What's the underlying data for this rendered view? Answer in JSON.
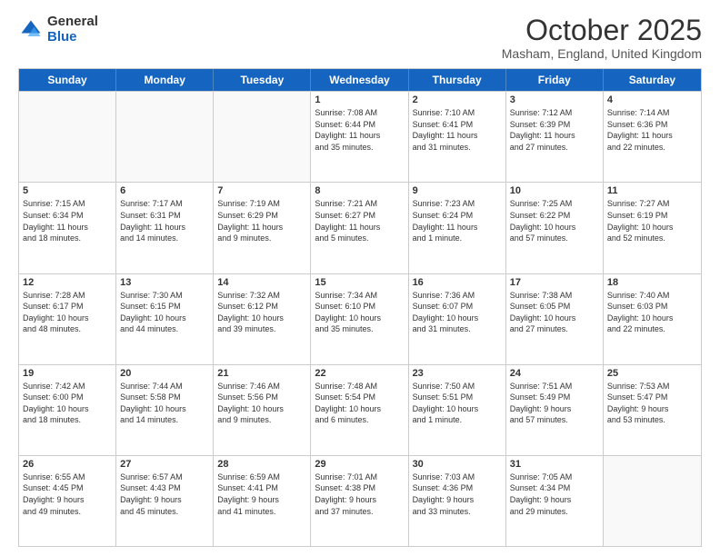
{
  "header": {
    "logo_general": "General",
    "logo_blue": "Blue",
    "month_title": "October 2025",
    "location": "Masham, England, United Kingdom"
  },
  "days_of_week": [
    "Sunday",
    "Monday",
    "Tuesday",
    "Wednesday",
    "Thursday",
    "Friday",
    "Saturday"
  ],
  "weeks": [
    [
      {
        "day": "",
        "info": ""
      },
      {
        "day": "",
        "info": ""
      },
      {
        "day": "",
        "info": ""
      },
      {
        "day": "1",
        "info": "Sunrise: 7:08 AM\nSunset: 6:44 PM\nDaylight: 11 hours\nand 35 minutes."
      },
      {
        "day": "2",
        "info": "Sunrise: 7:10 AM\nSunset: 6:41 PM\nDaylight: 11 hours\nand 31 minutes."
      },
      {
        "day": "3",
        "info": "Sunrise: 7:12 AM\nSunset: 6:39 PM\nDaylight: 11 hours\nand 27 minutes."
      },
      {
        "day": "4",
        "info": "Sunrise: 7:14 AM\nSunset: 6:36 PM\nDaylight: 11 hours\nand 22 minutes."
      }
    ],
    [
      {
        "day": "5",
        "info": "Sunrise: 7:15 AM\nSunset: 6:34 PM\nDaylight: 11 hours\nand 18 minutes."
      },
      {
        "day": "6",
        "info": "Sunrise: 7:17 AM\nSunset: 6:31 PM\nDaylight: 11 hours\nand 14 minutes."
      },
      {
        "day": "7",
        "info": "Sunrise: 7:19 AM\nSunset: 6:29 PM\nDaylight: 11 hours\nand 9 minutes."
      },
      {
        "day": "8",
        "info": "Sunrise: 7:21 AM\nSunset: 6:27 PM\nDaylight: 11 hours\nand 5 minutes."
      },
      {
        "day": "9",
        "info": "Sunrise: 7:23 AM\nSunset: 6:24 PM\nDaylight: 11 hours\nand 1 minute."
      },
      {
        "day": "10",
        "info": "Sunrise: 7:25 AM\nSunset: 6:22 PM\nDaylight: 10 hours\nand 57 minutes."
      },
      {
        "day": "11",
        "info": "Sunrise: 7:27 AM\nSunset: 6:19 PM\nDaylight: 10 hours\nand 52 minutes."
      }
    ],
    [
      {
        "day": "12",
        "info": "Sunrise: 7:28 AM\nSunset: 6:17 PM\nDaylight: 10 hours\nand 48 minutes."
      },
      {
        "day": "13",
        "info": "Sunrise: 7:30 AM\nSunset: 6:15 PM\nDaylight: 10 hours\nand 44 minutes."
      },
      {
        "day": "14",
        "info": "Sunrise: 7:32 AM\nSunset: 6:12 PM\nDaylight: 10 hours\nand 39 minutes."
      },
      {
        "day": "15",
        "info": "Sunrise: 7:34 AM\nSunset: 6:10 PM\nDaylight: 10 hours\nand 35 minutes."
      },
      {
        "day": "16",
        "info": "Sunrise: 7:36 AM\nSunset: 6:07 PM\nDaylight: 10 hours\nand 31 minutes."
      },
      {
        "day": "17",
        "info": "Sunrise: 7:38 AM\nSunset: 6:05 PM\nDaylight: 10 hours\nand 27 minutes."
      },
      {
        "day": "18",
        "info": "Sunrise: 7:40 AM\nSunset: 6:03 PM\nDaylight: 10 hours\nand 22 minutes."
      }
    ],
    [
      {
        "day": "19",
        "info": "Sunrise: 7:42 AM\nSunset: 6:00 PM\nDaylight: 10 hours\nand 18 minutes."
      },
      {
        "day": "20",
        "info": "Sunrise: 7:44 AM\nSunset: 5:58 PM\nDaylight: 10 hours\nand 14 minutes."
      },
      {
        "day": "21",
        "info": "Sunrise: 7:46 AM\nSunset: 5:56 PM\nDaylight: 10 hours\nand 9 minutes."
      },
      {
        "day": "22",
        "info": "Sunrise: 7:48 AM\nSunset: 5:54 PM\nDaylight: 10 hours\nand 6 minutes."
      },
      {
        "day": "23",
        "info": "Sunrise: 7:50 AM\nSunset: 5:51 PM\nDaylight: 10 hours\nand 1 minute."
      },
      {
        "day": "24",
        "info": "Sunrise: 7:51 AM\nSunset: 5:49 PM\nDaylight: 9 hours\nand 57 minutes."
      },
      {
        "day": "25",
        "info": "Sunrise: 7:53 AM\nSunset: 5:47 PM\nDaylight: 9 hours\nand 53 minutes."
      }
    ],
    [
      {
        "day": "26",
        "info": "Sunrise: 6:55 AM\nSunset: 4:45 PM\nDaylight: 9 hours\nand 49 minutes."
      },
      {
        "day": "27",
        "info": "Sunrise: 6:57 AM\nSunset: 4:43 PM\nDaylight: 9 hours\nand 45 minutes."
      },
      {
        "day": "28",
        "info": "Sunrise: 6:59 AM\nSunset: 4:41 PM\nDaylight: 9 hours\nand 41 minutes."
      },
      {
        "day": "29",
        "info": "Sunrise: 7:01 AM\nSunset: 4:38 PM\nDaylight: 9 hours\nand 37 minutes."
      },
      {
        "day": "30",
        "info": "Sunrise: 7:03 AM\nSunset: 4:36 PM\nDaylight: 9 hours\nand 33 minutes."
      },
      {
        "day": "31",
        "info": "Sunrise: 7:05 AM\nSunset: 4:34 PM\nDaylight: 9 hours\nand 29 minutes."
      },
      {
        "day": "",
        "info": ""
      }
    ]
  ]
}
